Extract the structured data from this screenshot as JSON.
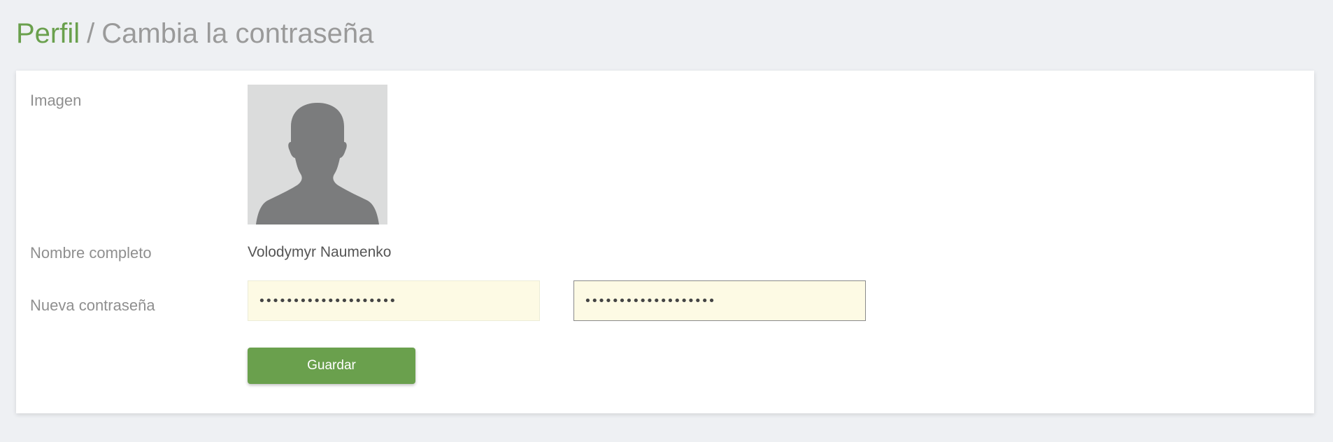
{
  "breadcrumb": {
    "parent": "Perfil",
    "separator": "/",
    "current": "Cambia la contraseña"
  },
  "form": {
    "image_label": "Imagen",
    "avatar_icon": "user-silhouette-icon",
    "full_name_label": "Nombre completo",
    "full_name_value": "Volodymyr Naumenko",
    "password_label": "Nueva contraseña",
    "password_value": "••••••••••••••••••••",
    "password_confirm_value": "•••••••••••••••••••"
  },
  "actions": {
    "save_label": "Guardar"
  },
  "colors": {
    "accent": "#6aa04d",
    "background": "#eef0f3",
    "input_fill": "#fdfae4",
    "muted_text": "#8f8f8f"
  }
}
